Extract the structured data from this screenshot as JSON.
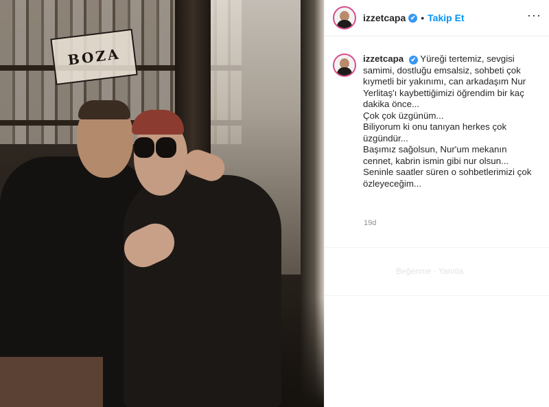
{
  "photo": {
    "sign_text": "BOZA"
  },
  "post": {
    "username": "izzetcapa",
    "verified_icon": "✔",
    "separator": "•",
    "follow_label": "Takip Et",
    "more_icon": "···"
  },
  "caption": {
    "username": "izzetcapa",
    "text": "Yüreği tertemiz, sevgisi samimi, dostluğu emsalsiz, sohbeti çok kıymetli bir yakınımı, can arkadaşım Nur Yerlitaş'ı kaybettiğimizi öğrendim bir kaç dakika önce...\nÇok çok üzgünüm...\nBiliyorum ki onu tanıyan herkes çok üzgündür...\nBaşımız sağolsun, Nur'um mekanın cennet, kabrin ismin gibi nur olsun...\nSeninle saatler süren o sohbetlerimizi çok özleyeceğim...",
    "time": "19d"
  },
  "faded": {
    "text": "Beğenme · Yanıtla"
  },
  "colors": {
    "follow": "#0095f6",
    "verified": "#3897f0",
    "story_ring": "#d94b8a"
  }
}
